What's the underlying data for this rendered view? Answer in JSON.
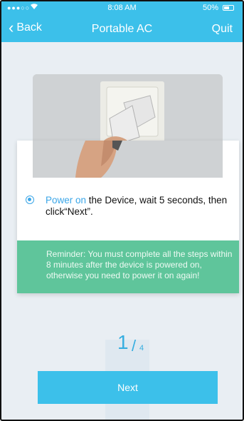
{
  "status_bar": {
    "signal": "●●●○○",
    "time": "8:08 AM",
    "battery": "50%"
  },
  "nav": {
    "back_label": "Back",
    "title": "Portable AC",
    "quit_label": "Quit"
  },
  "step": {
    "highlight": "Power on",
    "text_rest": " the Device, wait 5 seconds, then click“Next”."
  },
  "reminder": {
    "text": "Reminder: You must complete all the steps within 8 minutes after the device is powered on, otherwise you need to power it on again!"
  },
  "progress": {
    "current": "1",
    "separator": "/",
    "total": "4"
  },
  "next_button": {
    "label": "Next"
  }
}
